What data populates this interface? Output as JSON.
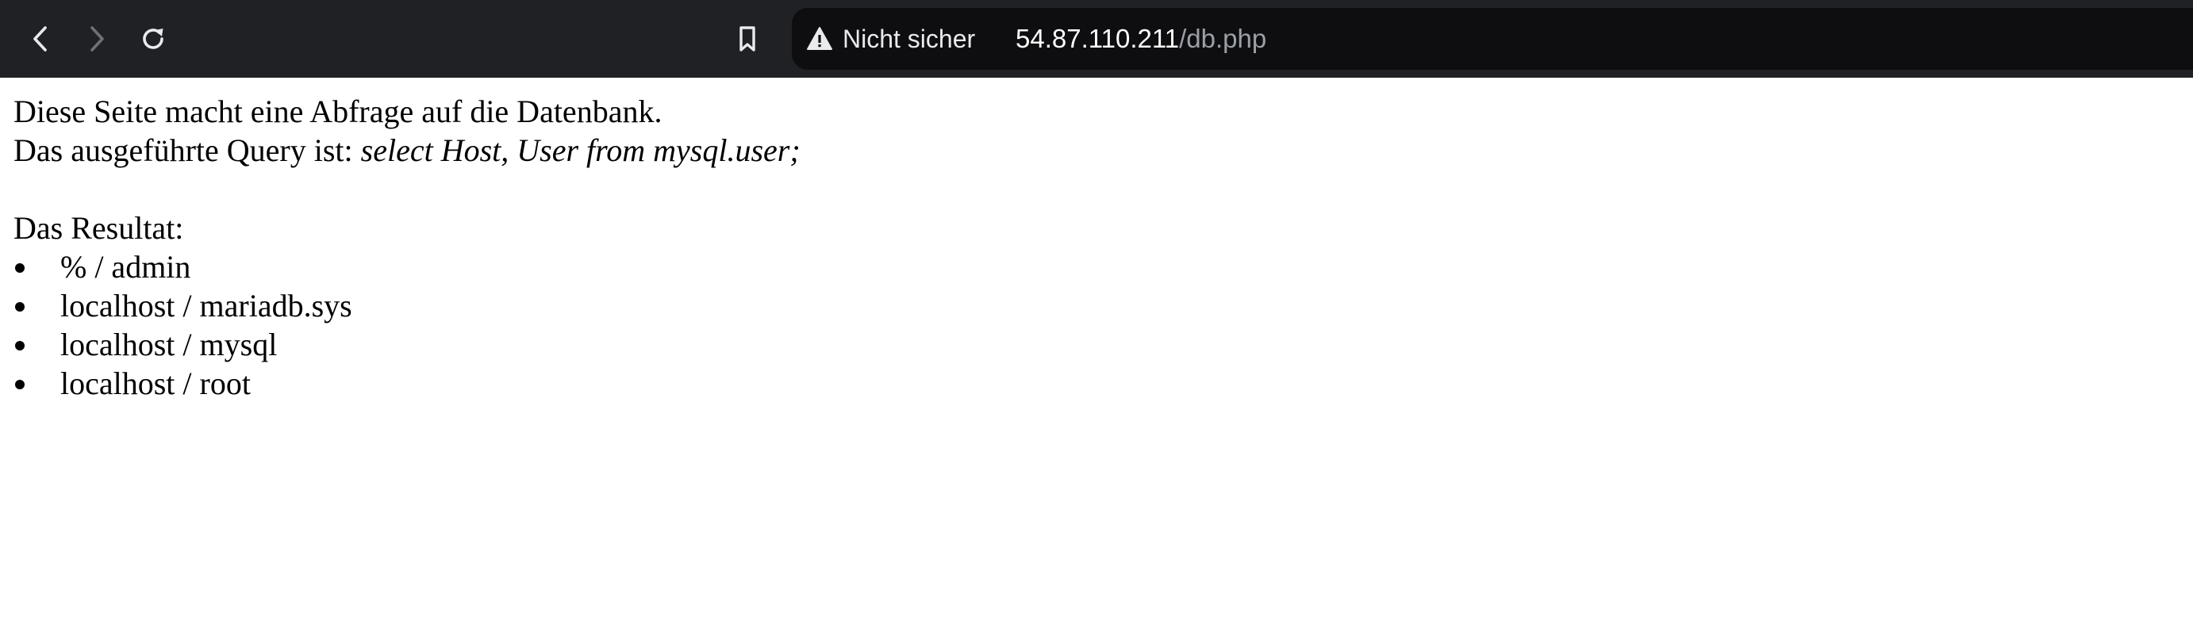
{
  "browser": {
    "security_label": "Nicht sicher",
    "url_host": "54.87.110.211",
    "url_path": "/db.php",
    "icons": {
      "back": "back-arrow-icon",
      "forward": "forward-arrow-icon",
      "reload": "reload-icon",
      "bookmark": "bookmark-icon",
      "warning": "warning-triangle-icon"
    },
    "colors": {
      "toolbar_bg": "#202124",
      "omnibox_bg": "#0e0e10"
    }
  },
  "page": {
    "intro": "Diese Seite macht eine Abfrage auf die Datenbank.",
    "query_prefix": "Das ausgeführte Query ist: ",
    "query": "select Host, User from mysql.user;",
    "result_label": "Das Resultat:",
    "results": [
      "% / admin",
      "localhost / mariadb.sys",
      "localhost / mysql",
      "localhost / root"
    ]
  }
}
